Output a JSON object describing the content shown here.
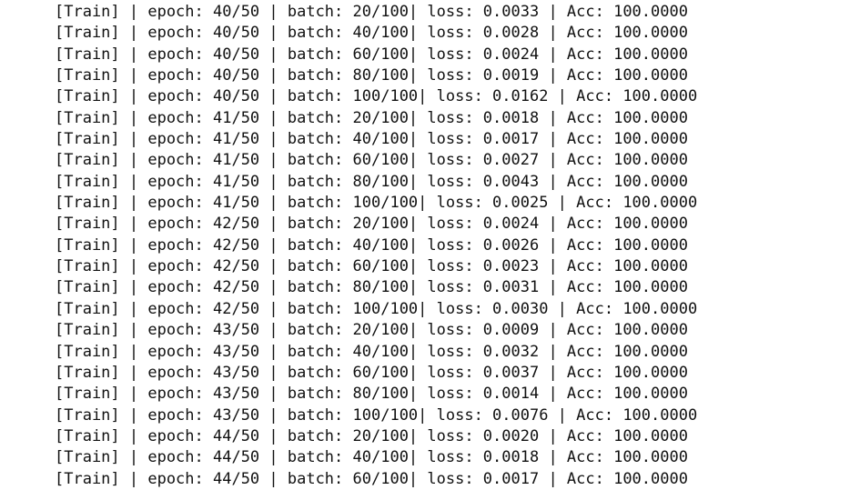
{
  "console": {
    "lines": [
      "[Train] | epoch: 40/50 | batch: 20/100| loss: 0.0033 | Acc: 100.0000",
      "[Train] | epoch: 40/50 | batch: 40/100| loss: 0.0028 | Acc: 100.0000",
      "[Train] | epoch: 40/50 | batch: 60/100| loss: 0.0024 | Acc: 100.0000",
      "[Train] | epoch: 40/50 | batch: 80/100| loss: 0.0019 | Acc: 100.0000",
      "[Train] | epoch: 40/50 | batch: 100/100| loss: 0.0162 | Acc: 100.0000",
      "[Train] | epoch: 41/50 | batch: 20/100| loss: 0.0018 | Acc: 100.0000",
      "[Train] | epoch: 41/50 | batch: 40/100| loss: 0.0017 | Acc: 100.0000",
      "[Train] | epoch: 41/50 | batch: 60/100| loss: 0.0027 | Acc: 100.0000",
      "[Train] | epoch: 41/50 | batch: 80/100| loss: 0.0043 | Acc: 100.0000",
      "[Train] | epoch: 41/50 | batch: 100/100| loss: 0.0025 | Acc: 100.0000",
      "[Train] | epoch: 42/50 | batch: 20/100| loss: 0.0024 | Acc: 100.0000",
      "[Train] | epoch: 42/50 | batch: 40/100| loss: 0.0026 | Acc: 100.0000",
      "[Train] | epoch: 42/50 | batch: 60/100| loss: 0.0023 | Acc: 100.0000",
      "[Train] | epoch: 42/50 | batch: 80/100| loss: 0.0031 | Acc: 100.0000",
      "[Train] | epoch: 42/50 | batch: 100/100| loss: 0.0030 | Acc: 100.0000",
      "[Train] | epoch: 43/50 | batch: 20/100| loss: 0.0009 | Acc: 100.0000",
      "[Train] | epoch: 43/50 | batch: 40/100| loss: 0.0032 | Acc: 100.0000",
      "[Train] | epoch: 43/50 | batch: 60/100| loss: 0.0037 | Acc: 100.0000",
      "[Train] | epoch: 43/50 | batch: 80/100| loss: 0.0014 | Acc: 100.0000",
      "[Train] | epoch: 43/50 | batch: 100/100| loss: 0.0076 | Acc: 100.0000",
      "[Train] | epoch: 44/50 | batch: 20/100| loss: 0.0020 | Acc: 100.0000",
      "[Train] | epoch: 44/50 | batch: 40/100| loss: 0.0018 | Acc: 100.0000",
      "[Train] | epoch: 44/50 | batch: 60/100| loss: 0.0017 | Acc: 100.0000"
    ]
  }
}
